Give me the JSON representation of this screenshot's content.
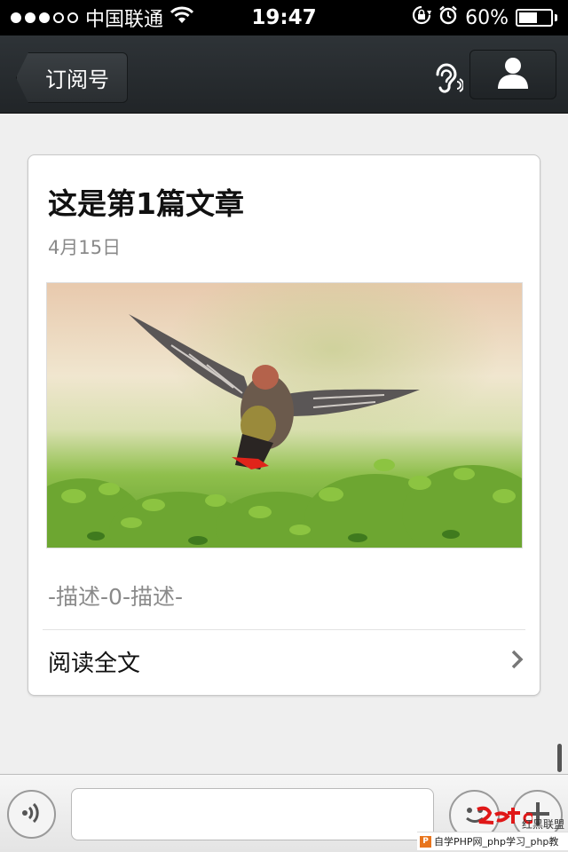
{
  "status_bar": {
    "carrier": "中国联通",
    "time": "19:47",
    "battery_text": "60%",
    "battery_level": 0.6,
    "signal_bars_filled": 3,
    "signal_bars_total": 5
  },
  "nav": {
    "back_label": "订阅号",
    "icons": [
      "ear-icon",
      "person-icon"
    ]
  },
  "article": {
    "title": "这是第1篇文章",
    "date": "4月15日",
    "description": "-描述-0-描述-",
    "read_more": "阅读全文"
  },
  "input_bar": {
    "icons": [
      "voice-icon",
      "emoji-icon",
      "plus-icon"
    ]
  },
  "watermark": {
    "brand": "红黑联盟",
    "caption": "自学PHP网_php学习_php教"
  },
  "colors": {
    "status_bar_bg": "#000000",
    "nav_bar_bg": "#262a2d",
    "page_bg": "#efefef",
    "card_bg": "#ffffff",
    "muted_text": "#8a8a8a"
  }
}
